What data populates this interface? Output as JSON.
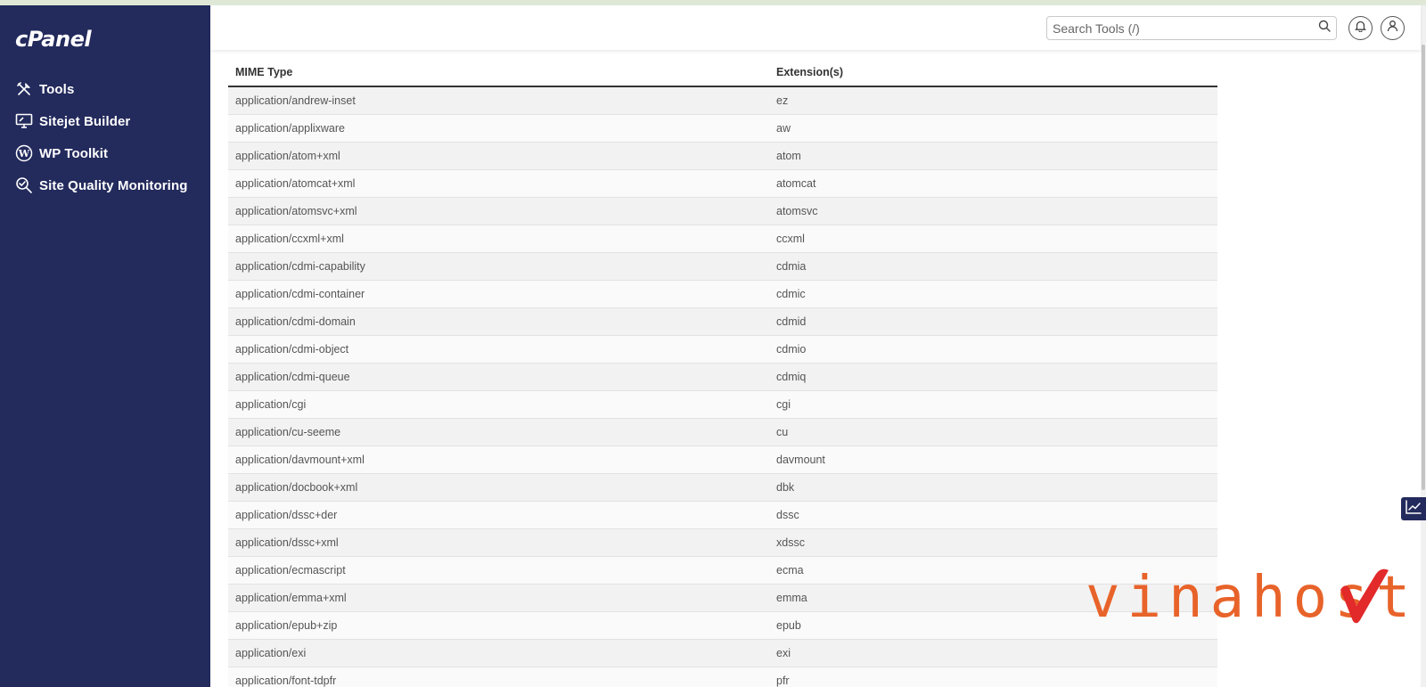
{
  "app": {
    "logo": "cPanel"
  },
  "sidebar": {
    "items": [
      {
        "label": "Tools",
        "icon": "tools-icon"
      },
      {
        "label": "Sitejet Builder",
        "icon": "monitor-icon"
      },
      {
        "label": "WP Toolkit",
        "icon": "wordpress-icon"
      },
      {
        "label": "Site Quality Monitoring",
        "icon": "magnifier-check-icon"
      }
    ]
  },
  "header": {
    "search_placeholder": "Search Tools (/)"
  },
  "table": {
    "headers": [
      "MIME Type",
      "Extension(s)"
    ],
    "rows": [
      [
        "application/andrew-inset",
        "ez"
      ],
      [
        "application/applixware",
        "aw"
      ],
      [
        "application/atom+xml",
        "atom"
      ],
      [
        "application/atomcat+xml",
        "atomcat"
      ],
      [
        "application/atomsvc+xml",
        "atomsvc"
      ],
      [
        "application/ccxml+xml",
        "ccxml"
      ],
      [
        "application/cdmi-capability",
        "cdmia"
      ],
      [
        "application/cdmi-container",
        "cdmic"
      ],
      [
        "application/cdmi-domain",
        "cdmid"
      ],
      [
        "application/cdmi-object",
        "cdmio"
      ],
      [
        "application/cdmi-queue",
        "cdmiq"
      ],
      [
        "application/cgi",
        "cgi"
      ],
      [
        "application/cu-seeme",
        "cu"
      ],
      [
        "application/davmount+xml",
        "davmount"
      ],
      [
        "application/docbook+xml",
        "dbk"
      ],
      [
        "application/dssc+der",
        "dssc"
      ],
      [
        "application/dssc+xml",
        "xdssc"
      ],
      [
        "application/ecmascript",
        "ecma"
      ],
      [
        "application/emma+xml",
        "emma"
      ],
      [
        "application/epub+zip",
        "epub"
      ],
      [
        "application/exi",
        "exi"
      ],
      [
        "application/font-tdpfr",
        "pfr"
      ]
    ]
  },
  "watermark": {
    "text": "vinahost."
  },
  "colors": {
    "sidebar": "#232a5c",
    "watermark": "#e8632a",
    "check": "#e22a2a"
  }
}
